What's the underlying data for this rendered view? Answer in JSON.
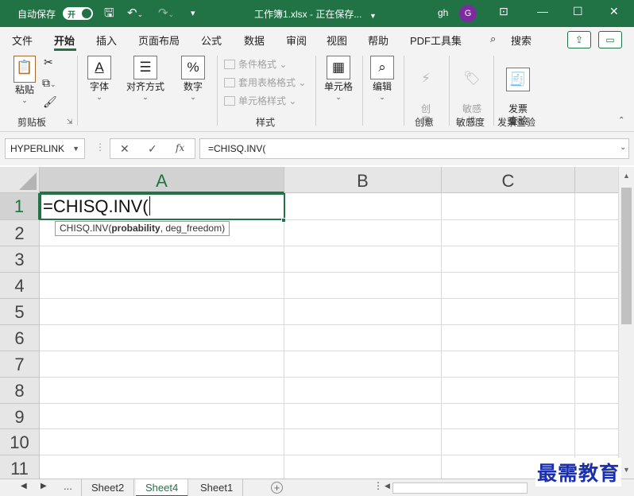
{
  "titlebar": {
    "autosave_label": "自动保存",
    "autosave_toggle": "开",
    "doc_title": "工作簿1.xlsx  -  正在保存...",
    "user": "gh",
    "avatar_initial": "G",
    "accent_color": "#217346"
  },
  "ribbon_tabs": [
    "文件",
    "开始",
    "插入",
    "页面布局",
    "公式",
    "数据",
    "审阅",
    "视图",
    "帮助",
    "PDF工具集",
    "搜索"
  ],
  "ribbon": {
    "paste": "粘贴",
    "clipboard_group": "剪贴板",
    "font": "字体",
    "align": "对齐方式",
    "number": "数字",
    "conditional_format": "条件格式",
    "table_format": "套用表格格式",
    "cell_style": "单元格样式",
    "styles_group": "样式",
    "cells": "单元格",
    "editing": "编辑",
    "creative": "创\n意",
    "creative_group": "创意",
    "sensitivity": "敏感\n性",
    "sensitivity_group": "敏感度",
    "invoice": "发票\n查验",
    "invoice_group": "发票查验"
  },
  "formula_bar": {
    "name_box": "HYPERLINK",
    "fx": "fx",
    "formula": "=CHISQ.INV("
  },
  "grid": {
    "columns": [
      "A",
      "B",
      "C"
    ],
    "rows": [
      "1",
      "2",
      "3",
      "4",
      "5",
      "6",
      "7",
      "8",
      "9",
      "10",
      "11"
    ],
    "active_cell_text": "=CHISQ.INV(",
    "tooltip_func": "CHISQ.INV(",
    "tooltip_arg1": "probability",
    "tooltip_rest": ", deg_freedom)"
  },
  "sheets": {
    "ellipsis": "...",
    "tabs": [
      "Sheet2",
      "Sheet4",
      "Sheet1"
    ],
    "active": "Sheet4"
  },
  "watermark": "最需教育"
}
